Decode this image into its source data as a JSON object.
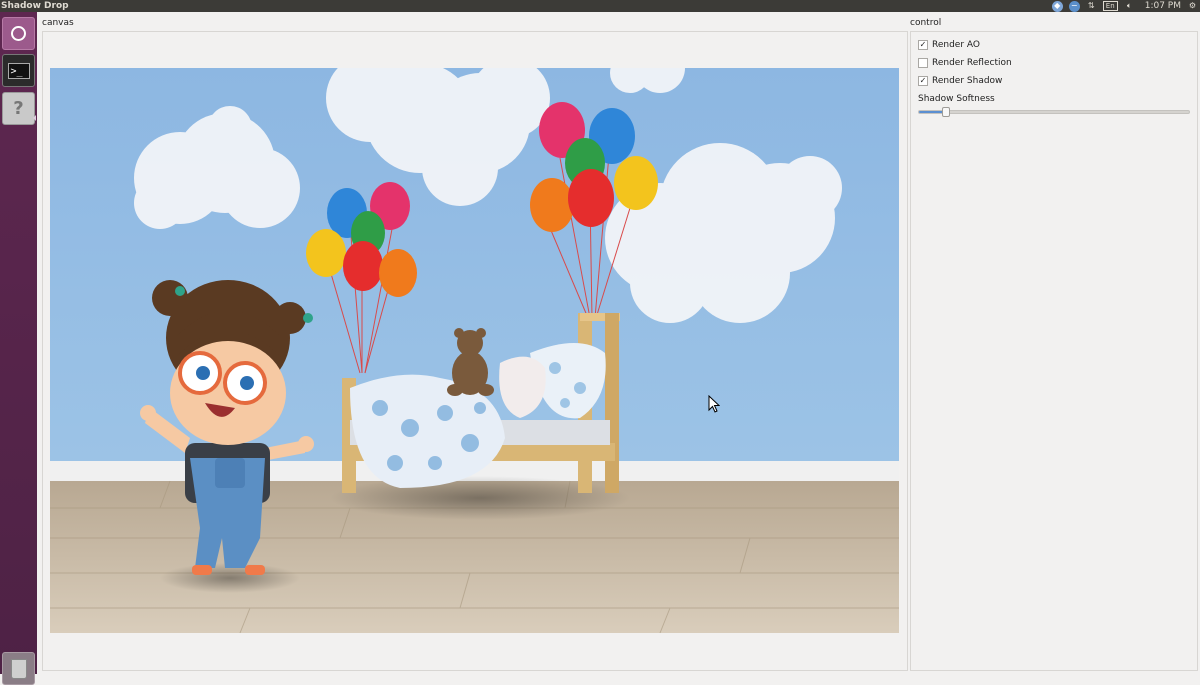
{
  "window": {
    "title": "Shadow Drop"
  },
  "panel": {
    "indicators": [
      "dropbox-icon",
      "network-icon",
      "transfer-icon",
      "keyboard-layout-icon",
      "volume-icon"
    ],
    "keyboard_layout": "En",
    "time": "1:07 PM"
  },
  "launcher": {
    "items": [
      {
        "name": "dash-home",
        "icon": "ubuntu-logo-icon"
      },
      {
        "name": "terminal",
        "icon": "terminal-icon"
      },
      {
        "name": "help",
        "icon": "question-icon",
        "glyph": "?"
      },
      {
        "name": "trash",
        "icon": "trash-icon"
      }
    ]
  },
  "canvas": {
    "group_label": "canvas"
  },
  "control": {
    "group_label": "control",
    "checkboxes": [
      {
        "label": "Render AO",
        "checked": true
      },
      {
        "label": "Render Reflection",
        "checked": false
      },
      {
        "label": "Render Shadow",
        "checked": true
      }
    ],
    "slider": {
      "label": "Shadow Softness",
      "value": 0.1
    }
  },
  "colors": {
    "panel_bg": "#3c3b37",
    "launcher_bg": "#5e2750",
    "window_bg": "#f2f1f0",
    "wall": "#8fb9e0",
    "floor": "#c7b9a4",
    "slider_fill": "#5b8fd1"
  }
}
